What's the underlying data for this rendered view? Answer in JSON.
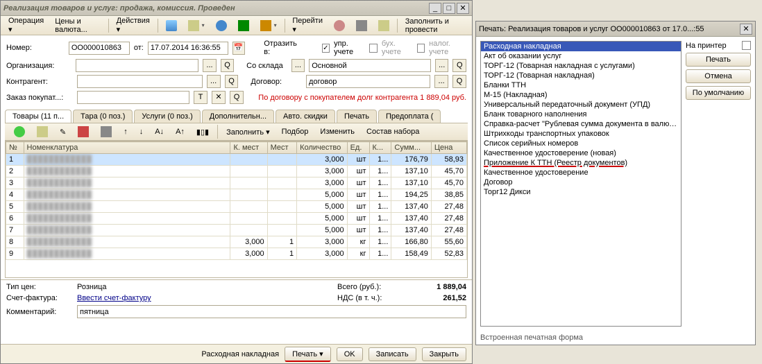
{
  "main": {
    "title": "Реализация товаров и услуг: продажа, комиссия. Проведен",
    "toolbar": {
      "operation": "Операция ▾",
      "prices": "Цены и валюта...",
      "actions": "Действия ▾",
      "goto": "Перейти ▾",
      "fill_post": "Заполнить и провести"
    },
    "form": {
      "number_lbl": "Номер:",
      "number": "ОО000010863",
      "from_lbl": "от:",
      "date": "17.07.2014 16:36:55",
      "reflect_lbl": "Отразить в:",
      "chk_upr": "упр. учете",
      "chk_buh": "бух. учете",
      "chk_nal": "налог. учете",
      "org_lbl": "Организация:",
      "from_stock_lbl": "Со склада",
      "warehouse": "Основной",
      "counterparty_lbl": "Контрагент:",
      "contract_lbl": "Договор:",
      "contract": "договор",
      "order_lbl": "Заказ покупат...:",
      "debt": "По договору с покупателем долг контрагента 1 889,04 руб."
    },
    "tabs": [
      "Товары (11 п...",
      "Тара (0 поз.)",
      "Услуги (0 поз.)",
      "Дополнительн...",
      "Авто. скидки",
      "Печать",
      "Предоплата ("
    ],
    "grid_tb": {
      "fill": "Заполнить ▾",
      "select": "Подбор",
      "edit": "Изменить",
      "composition": "Состав набора"
    },
    "grid": {
      "cols": [
        "№",
        "Номенклатура",
        "К. мест",
        "Мест",
        "Количество",
        "Ед.",
        "К...",
        "Сумм...",
        "Цена"
      ],
      "rows": [
        {
          "n": 1,
          "kmest": "",
          "mest": "",
          "qty": "3,000",
          "ed": "шт",
          "k": "1...",
          "sum": "176,79",
          "price": "58,93",
          "sel": true
        },
        {
          "n": 2,
          "kmest": "",
          "mest": "",
          "qty": "3,000",
          "ed": "шт",
          "k": "1...",
          "sum": "137,10",
          "price": "45,70"
        },
        {
          "n": 3,
          "kmest": "",
          "mest": "",
          "qty": "3,000",
          "ed": "шт",
          "k": "1...",
          "sum": "137,10",
          "price": "45,70"
        },
        {
          "n": 4,
          "kmest": "",
          "mest": "",
          "qty": "5,000",
          "ed": "шт",
          "k": "1...",
          "sum": "194,25",
          "price": "38,85"
        },
        {
          "n": 5,
          "kmest": "",
          "mest": "",
          "qty": "5,000",
          "ed": "шт",
          "k": "1...",
          "sum": "137,40",
          "price": "27,48"
        },
        {
          "n": 6,
          "kmest": "",
          "mest": "",
          "qty": "5,000",
          "ed": "шт",
          "k": "1...",
          "sum": "137,40",
          "price": "27,48"
        },
        {
          "n": 7,
          "kmest": "",
          "mest": "",
          "qty": "5,000",
          "ed": "шт",
          "k": "1...",
          "sum": "137,40",
          "price": "27,48"
        },
        {
          "n": 8,
          "kmest": "3,000",
          "mest": "1",
          "qty": "3,000",
          "ed": "кг",
          "k": "1...",
          "sum": "166,80",
          "price": "55,60"
        },
        {
          "n": 9,
          "kmest": "3,000",
          "mest": "1",
          "qty": "3,000",
          "ed": "кг",
          "k": "1...",
          "sum": "158,49",
          "price": "52,83"
        }
      ]
    },
    "bottom": {
      "price_type_lbl": "Тип цен:",
      "price_type": "Розница",
      "total_lbl": "Всего (руб.):",
      "total": "1 889,04",
      "invoice_lbl": "Счет-фактура:",
      "invoice_link": "Ввести счет-фактуру",
      "vat_lbl": "НДС (в т. ч.):",
      "vat": "261,52",
      "comment_lbl": "Комментарий:",
      "comment": "пятница"
    },
    "footer": {
      "rn": "Расходная накладная",
      "print": "Печать ▾",
      "ok": "OK",
      "save": "Записать",
      "close": "Закрыть"
    }
  },
  "print": {
    "title": "Печать: Реализация товаров и услуг ОО000010863 от 17.0...:55",
    "to_printer": "На принтер",
    "btn_print": "Печать",
    "btn_cancel": "Отмена",
    "btn_default": "По умолчанию",
    "status": "Встроенная печатная форма",
    "items": [
      "Расходная накладная",
      "Акт об оказании услуг",
      "ТОРГ-12 (Товарная накладная с услугами)",
      "ТОРГ-12 (Товарная накладная)",
      "Бланки ТТН",
      "М-15 (Накладная)",
      "Универсальный передаточный документ (УПД)",
      "Бланк товарного наполнения",
      "Справка-расчет \"Рублевая сумма документа в валюте\"",
      "Штрихкоды транспортных упаковок",
      "Список серийных номеров",
      "Качественное удостоверение (новая)",
      "Приложение К ТТН (Реестр документов)",
      "Качественное удостоверение",
      "Договор",
      "Торг12 Дикси"
    ]
  }
}
